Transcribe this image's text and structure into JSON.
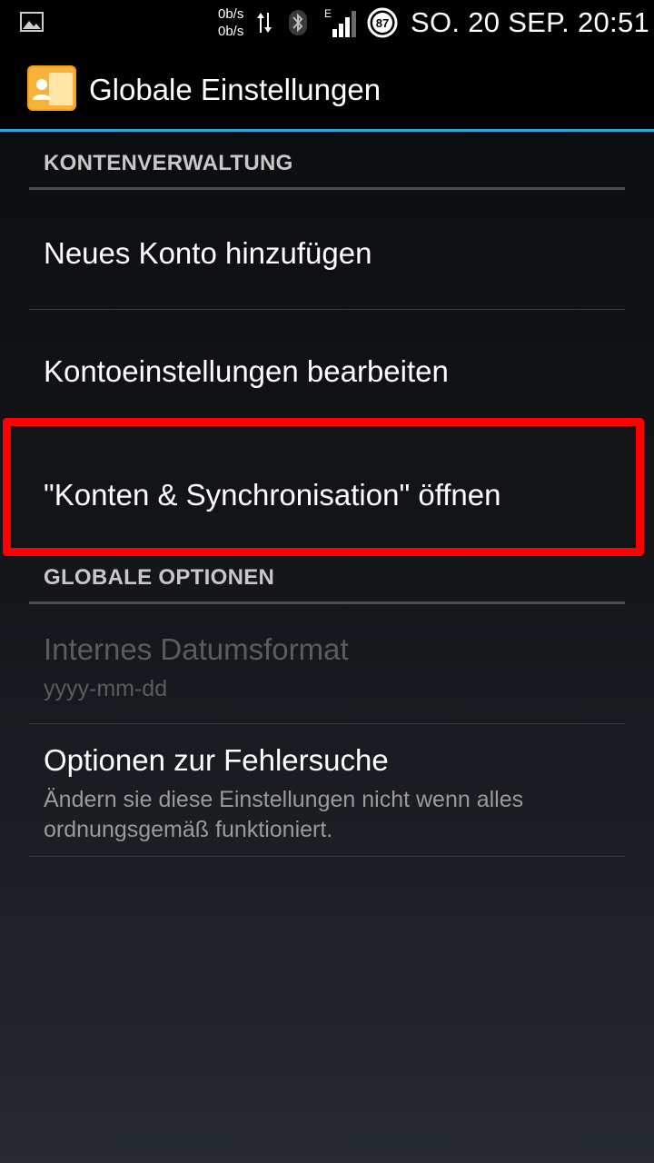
{
  "status_bar": {
    "speed_up": "0b/s",
    "speed_down": "0b/s",
    "network_type": "E",
    "battery_level": "87",
    "clock": "SO. 20 SEP. 20:51"
  },
  "action_bar": {
    "title": "Globale Einstellungen"
  },
  "sections": [
    {
      "header": "KONTENVERWALTUNG",
      "items": [
        {
          "title": "Neues Konto hinzufügen"
        },
        {
          "title": "Kontoeinstellungen bearbeiten"
        },
        {
          "title": "\"Konten & Synchronisation\" öffnen"
        }
      ]
    },
    {
      "header": "GLOBALE OPTIONEN",
      "items": [
        {
          "title": "Internes Datumsformat",
          "summary": "yyyy-mm-dd",
          "enabled": false
        },
        {
          "title": "Optionen zur Fehlersuche",
          "summary": "Ändern sie diese Einstellungen nicht wenn alles ordnungsgemäß funktioniert."
        }
      ]
    }
  ],
  "colors": {
    "accent": "#2fa6d8",
    "highlight": "#ff0000"
  }
}
